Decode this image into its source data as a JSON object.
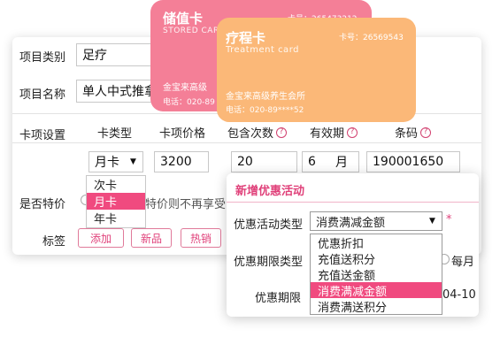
{
  "form": {
    "category_label": "项目类别",
    "category_value": "足疗",
    "name_label": "项目名称",
    "name_value": "单人中式推拿",
    "card_settings_label": "卡项设置",
    "columns": [
      "卡类型",
      "卡项价格",
      "包含次数",
      "有效期",
      "条码"
    ],
    "card_type_value": "月卡",
    "price_value": "3200",
    "count_value": "20",
    "validity_value": "6",
    "validity_unit": "月",
    "barcode_value": "190001650",
    "special_label": "是否特价",
    "special_note": "特价则不再享受",
    "tags_label": "标签",
    "tags": [
      "添加",
      "新品",
      "热销"
    ],
    "card_type_options": [
      "次卡",
      "月卡",
      "年卡"
    ],
    "card_type_selected": "月卡"
  },
  "cards": {
    "stored": {
      "title": "储值卡",
      "subtitle": "STORED CARD",
      "number": "卡号：265473212",
      "store": "金宝来高级",
      "phone": "电话：020-89"
    },
    "treatment": {
      "title": "疗程卡",
      "subtitle": "Treatment card",
      "number": "卡号：26569543",
      "store": "金宝来高级养生会所",
      "phone": "电话：020-89****52"
    }
  },
  "dialog": {
    "title": "新增优惠活动",
    "type_label": "优惠活动类型",
    "type_value": "消费满减金额",
    "required_mark": "*",
    "period_type_label": "优惠期限类型",
    "period_type_option": "每月",
    "period_label": "优惠期限",
    "period_date_suffix": "04-10",
    "options": [
      "优惠折扣",
      "充值送积分",
      "充值送金额",
      "消费满减金额",
      "消费满送积分"
    ],
    "selected": "消费满减金额"
  },
  "colors": {
    "accent": "#e0417a",
    "highlight": "#f04a7f",
    "stored_card": "#f47f97",
    "treatment_card": "#fbb878"
  }
}
